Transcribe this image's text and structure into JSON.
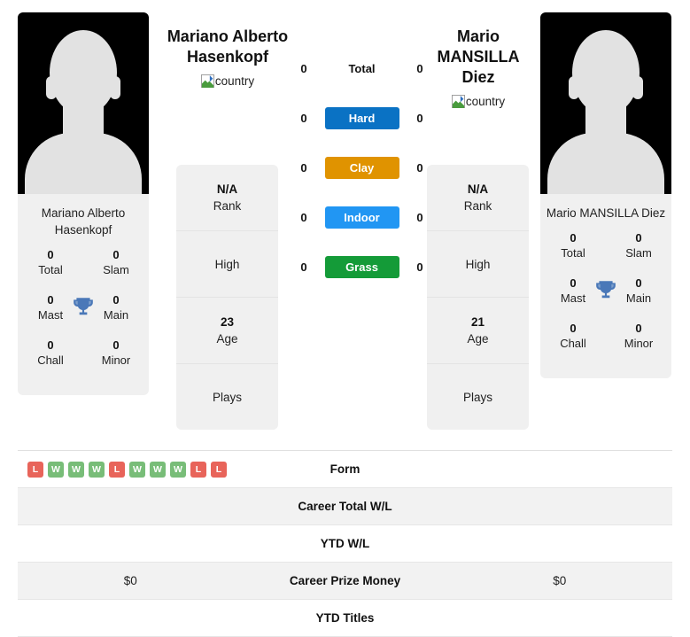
{
  "players": {
    "left": {
      "display_name_line1": "Mariano Alberto",
      "display_name_line2": "Hasenkopf",
      "country_alt": "country",
      "card_name": "Mariano Alberto Hasenkopf",
      "titles": {
        "total_value": "0",
        "total_label": "Total",
        "slam_value": "0",
        "slam_label": "Slam",
        "mast_value": "0",
        "mast_label": "Mast",
        "main_value": "0",
        "main_label": "Main",
        "chall_value": "0",
        "chall_label": "Chall",
        "minor_value": "0",
        "minor_label": "Minor"
      },
      "info": {
        "rank_value": "N/A",
        "rank_label": "Rank",
        "high_value": "",
        "high_label": "High",
        "age_value": "23",
        "age_label": "Age",
        "plays_value": "",
        "plays_label": "Plays"
      },
      "career_total_wl": "",
      "ytd_wl": "",
      "career_prize_money": "$0",
      "ytd_titles": "",
      "form": [
        "L",
        "W",
        "W",
        "W",
        "L",
        "W",
        "W",
        "W",
        "L",
        "L"
      ]
    },
    "right": {
      "display_name_line1": "Mario",
      "display_name_line2": "MANSILLA",
      "display_name_line3": "Diez",
      "country_alt": "country",
      "card_name": "Mario MANSILLA Diez",
      "titles": {
        "total_value": "0",
        "total_label": "Total",
        "slam_value": "0",
        "slam_label": "Slam",
        "mast_value": "0",
        "mast_label": "Mast",
        "main_value": "0",
        "main_label": "Main",
        "chall_value": "0",
        "chall_label": "Chall",
        "minor_value": "0",
        "minor_label": "Minor"
      },
      "info": {
        "rank_value": "N/A",
        "rank_label": "Rank",
        "high_value": "",
        "high_label": "High",
        "age_value": "21",
        "age_label": "Age",
        "plays_value": "",
        "plays_label": "Plays"
      },
      "career_total_wl": "",
      "ytd_wl": "",
      "career_prize_money": "$0",
      "ytd_titles": "",
      "form": []
    }
  },
  "head_to_head": {
    "rows": [
      {
        "label": "Total",
        "left": "0",
        "right": "0",
        "color": "",
        "style": "plain"
      },
      {
        "label": "Hard",
        "left": "0",
        "right": "0",
        "color": "#0a72c4",
        "style": "pill"
      },
      {
        "label": "Clay",
        "left": "0",
        "right": "0",
        "color": "#e09300",
        "style": "pill"
      },
      {
        "label": "Indoor",
        "left": "0",
        "right": "0",
        "color": "#2196f3",
        "style": "pill"
      },
      {
        "label": "Grass",
        "left": "0",
        "right": "0",
        "color": "#149b38",
        "style": "pill"
      }
    ]
  },
  "stats_table": {
    "rows": [
      {
        "label": "Form",
        "left": "",
        "right": "",
        "shaded": false,
        "type": "form"
      },
      {
        "label": "Career Total W/L",
        "left": "",
        "right": "",
        "shaded": true,
        "type": "text"
      },
      {
        "label": "YTD W/L",
        "left": "",
        "right": "",
        "shaded": false,
        "type": "text"
      },
      {
        "label": "Career Prize Money",
        "left": "$0",
        "right": "$0",
        "shaded": true,
        "type": "text"
      },
      {
        "label": "YTD Titles",
        "left": "",
        "right": "",
        "shaded": false,
        "type": "text"
      }
    ]
  },
  "colors": {
    "win_badge": "#78bd78",
    "loss_badge": "#e8645a",
    "trophy": "#4a78b8",
    "card_bg": "#f0f0f0",
    "row_shade": "#f2f2f2"
  }
}
